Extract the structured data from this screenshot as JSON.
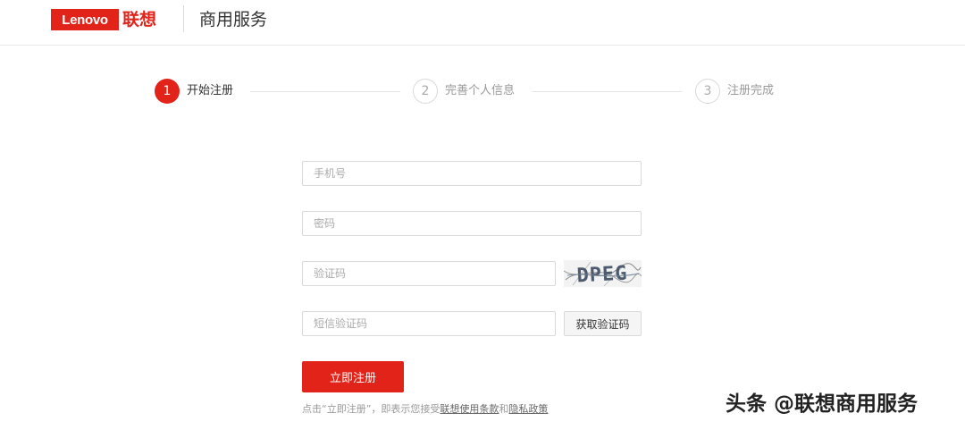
{
  "header": {
    "logo_text": "Lenovo",
    "logo_cn": "联想",
    "title": "商用服务"
  },
  "steps": [
    {
      "number": "1",
      "label": "开始注册",
      "state": "active"
    },
    {
      "number": "2",
      "label": "完善个人信息",
      "state": "inactive"
    },
    {
      "number": "3",
      "label": "注册完成",
      "state": "inactive"
    }
  ],
  "form": {
    "phone_placeholder": "手机号",
    "password_placeholder": "密码",
    "captcha_placeholder": "验证码",
    "captcha_image_text": "DPEG",
    "sms_placeholder": "短信验证码",
    "sms_button": "获取验证码",
    "submit_button": "立即注册"
  },
  "agreement": {
    "prefix": "点击“立即注册”，即表示您接受",
    "terms_link": "联想使用条款",
    "conjunction": "和",
    "privacy_link": "隐私政策"
  },
  "watermark": "头条 @联想商用服务",
  "colors": {
    "brand": "#e2231a",
    "border": "#d9d9d9"
  }
}
